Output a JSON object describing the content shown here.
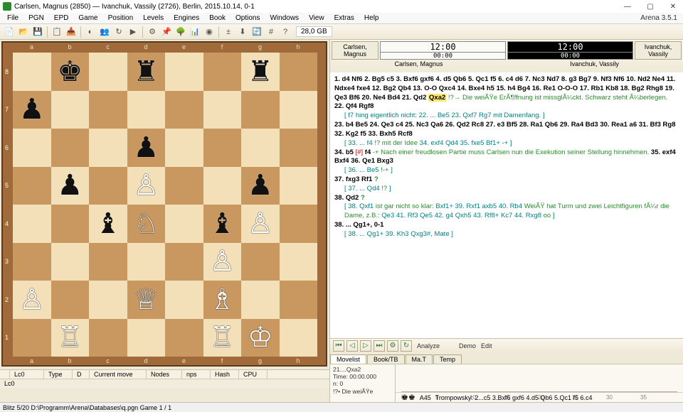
{
  "window": {
    "title": "Carlsen, Magnus (2850)  —  Ivanchuk, Vassily (2726),   Berlin,   2015.10.14,   0-1",
    "app_name": "Arena 3.5.1"
  },
  "menu": {
    "items": [
      "File",
      "PGN",
      "EPD",
      "Game",
      "Position",
      "Levels",
      "Engines",
      "Book",
      "Options",
      "Windows",
      "View",
      "Extras",
      "Help"
    ]
  },
  "toolbar": {
    "memory": "28,0 GB",
    "icons": [
      "new-icon",
      "open-icon",
      "save-icon",
      "copy-icon",
      "paste-icon",
      "toggle-icon",
      "people-icon",
      "refresh-icon",
      "play-icon",
      "cog-icon",
      "pin-icon",
      "tree-icon",
      "graph-icon",
      "node-icon",
      "eval-icon",
      "load-icon",
      "refresh2-icon",
      "mate-icon",
      "help-icon"
    ]
  },
  "board": {
    "files": [
      "a",
      "b",
      "c",
      "d",
      "e",
      "f",
      "g",
      "h"
    ],
    "ranks": [
      "8",
      "7",
      "6",
      "5",
      "4",
      "3",
      "2",
      "1"
    ],
    "position_rows": [
      [
        ".",
        "k",
        ".",
        "r",
        ".",
        ".",
        "r",
        "."
      ],
      [
        "p",
        ".",
        ".",
        ".",
        ".",
        ".",
        ".",
        "."
      ],
      [
        ".",
        ".",
        ".",
        "p",
        ".",
        ".",
        ".",
        "."
      ],
      [
        ".",
        "p",
        ".",
        "P",
        ".",
        ".",
        "p",
        "."
      ],
      [
        ".",
        ".",
        "b",
        "N",
        ".",
        "b",
        "P",
        "."
      ],
      [
        ".",
        ".",
        ".",
        ".",
        ".",
        "P",
        ".",
        "."
      ],
      [
        "P",
        ".",
        ".",
        "Q",
        ".",
        "B",
        ".",
        "."
      ],
      [
        ".",
        "R",
        ".",
        ".",
        ".",
        "R",
        "K",
        "."
      ]
    ]
  },
  "clocks": {
    "white": {
      "name": "Carlsen, Magnus",
      "main": "12:00",
      "sub": "00:00"
    },
    "black": {
      "name": "Ivanchuk, Vassily",
      "main": "12:00",
      "sub": "00:00"
    }
  },
  "notation": {
    "main1": "1. d4 Nf6 2. Bg5 c5 3. Bxf6 gxf6 4. d5 Qb6 5. Qc1 f5 6. c4 d6 7. Nc3 Nd7 8. g3 Bg7 9. Nf3 Nf6 10. Nd2 Ne4 11. Ndxe4 fxe4 12. Bg2 Qb4 13. O-O Qxc4 14. Bxe4 h5 15. h4 Bg4 16. Re1 O-O-O 17. Rb1 Kb8 18. Bg2 Rhg8 19. Qe3 Bf6 20. Ne4 Bd4 21. Qd2",
    "hl_move": "Qxa2",
    "ann1": "!?→ Die weiÃŸe ErÃ¶ffnung ist missglÃ¼ckt. Schwarz steht Ã¼berlegen.",
    "main2": "22. Qf4 Rgf8",
    "sub1": "[ f7 hing eigentlich nicht: 22. ... Be5 23. Qxf7 Rg7 mit Damenfang. ]",
    "main3": "23. b4 Be5 24. Qe3 c4 25. Nc3 Qa6 26. Qd2 Rc8 27. e3 Bf5 28. Ra1 Qb6 29. Ra4 Bd3 30. Rea1 a6 31. Bf3 Rg8 32. Kg2 f5 33. Bxh5 Rcf8",
    "sub2_a": "[ 33. ... f4",
    "sub2_b": "!? mit der Idee",
    "sub2_c": " 34. exf4 Qd4 35. fxe5 Bf1+ -+ ]",
    "main4a": "34. b5",
    "main4red": "[#]",
    "main4bold": "f4",
    "main4ann": "-+ Nach einer freudlosen Partie muss Carlsen nun die Exekution seiner Stellung hinnehmen.",
    "main4b": "35. exf4 Bxf4 36. Qe1 Bxg3",
    "sub3a": "[ 36. ... Be5",
    "sub3b": "!-+",
    "sub3c": " ]",
    "main5": "37. fxg3 Rf1",
    "main5q": "?",
    "sub4a": "[ 37. ... Qd4",
    "sub4b": "!?",
    "sub4c": " ]",
    "main6": "38. Qd2",
    "main6q": "?",
    "sub5a": "[ 38. Qxf1",
    "sub5b": " ist gar nicht so klar:",
    "sub5c": " Bxf1+ 39. Rxf1 axb5 40. Rb4",
    "sub5d": " WeiÃŸ hat Turm und zwei Leichtfiguren fÃ¼r die Dame, z.B.:",
    "sub5e": " Qe3 41. Rf3 Qe5 42. g4 Qxh5 43. Rf8+ Kc7 44. Rxg8",
    "sub5f": " oo",
    "sub5g": " ]",
    "main7": "38. ... Qg1+, 0-1",
    "sub6": "[ 38. ... Qg1+ 39. Kh3 Qxg3#, Mate ]"
  },
  "engine_table": {
    "cols": [
      "",
      "Lc0",
      "Type",
      "D",
      "Current move",
      "Nodes",
      "nps",
      "Hash",
      "CPU"
    ],
    "row": "Lc0"
  },
  "analysis": {
    "labels": {
      "analyze": "Analyze",
      "demo": "Demo",
      "edit": "Edit"
    }
  },
  "tabs": {
    "items": [
      "Movelist",
      "Book/TB",
      "Ma.T",
      "Temp"
    ],
    "activeIndex": 0
  },
  "movebox": {
    "l1": "21....Qxa2",
    "l2": "Time: 00:00.000",
    "l3": "n: 0",
    "l4": "!?• Die weiÃŸe"
  },
  "eval_scale": {
    "ticks": [
      "0",
      "5",
      "10",
      "15",
      "20",
      "25",
      "30",
      "35"
    ]
  },
  "opening": {
    "code": "A45",
    "name": "Trompowsky: 2...c5 3.Bxf6 gxf6 4.d5 Qb6 5.Qc1 f5 6.c4"
  },
  "status": {
    "text": "Blitz 5/20   D:\\Programm\\Arena\\Databases\\q.pgn  Game 1 / 1"
  }
}
